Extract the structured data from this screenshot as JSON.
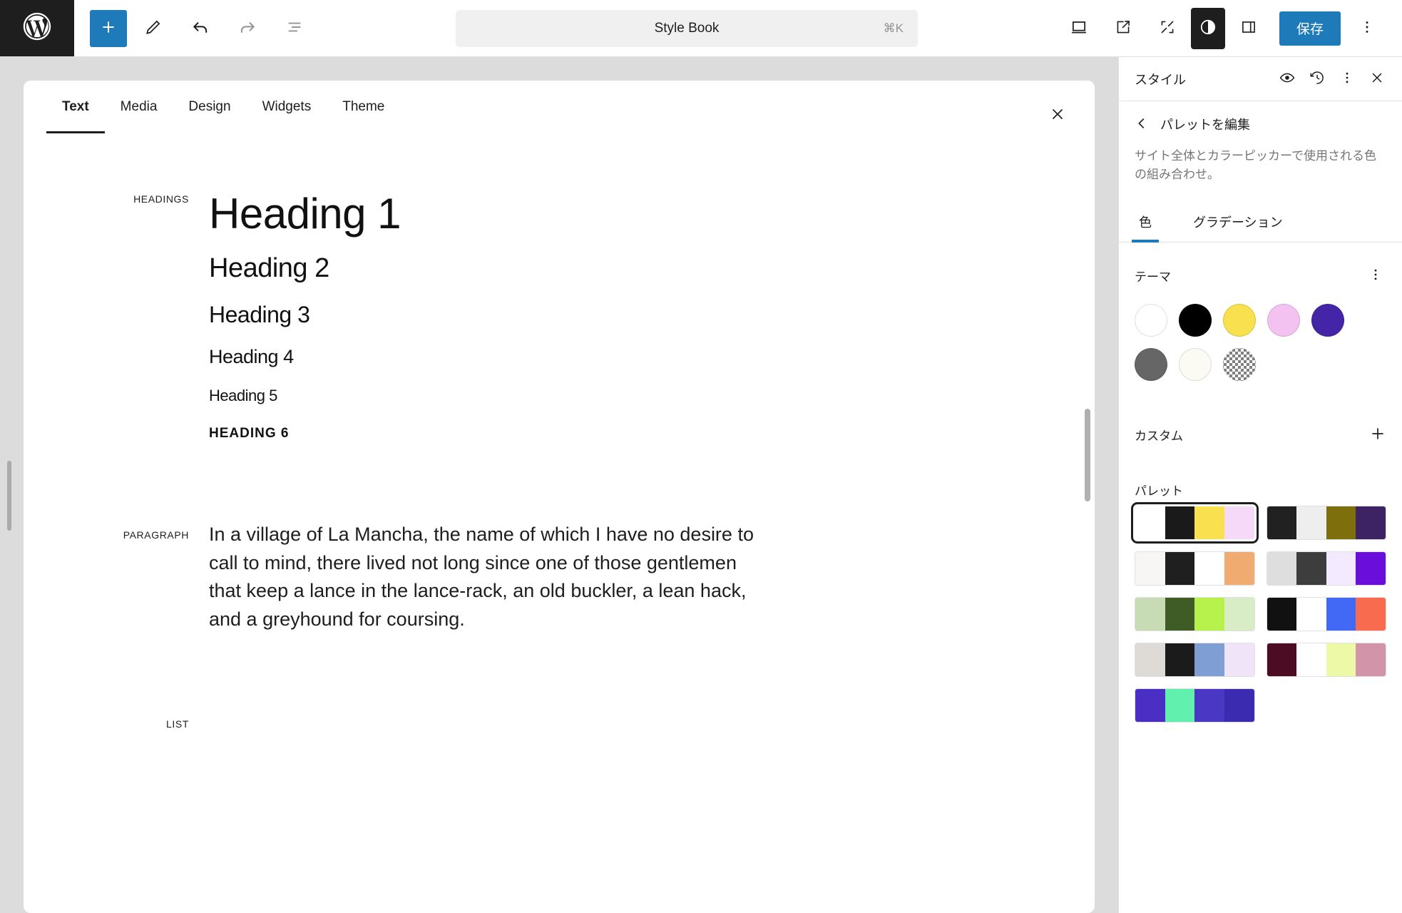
{
  "topbar": {
    "logo_icon": "wordpress-logo-icon",
    "tools": [
      {
        "name": "add-block-button",
        "icon": "plus-icon"
      },
      {
        "name": "edit-tool-button",
        "icon": "pencil-icon"
      },
      {
        "name": "undo-button",
        "icon": "undo-arrow-icon"
      },
      {
        "name": "redo-button",
        "icon": "redo-arrow-icon"
      },
      {
        "name": "document-overview-button",
        "icon": "list-view-icon"
      }
    ],
    "command_bar": {
      "title": "Style Book",
      "shortcut": "⌘K"
    },
    "right_tools": [
      {
        "name": "device-preview-button",
        "icon": "desktop-icon"
      },
      {
        "name": "view-site-button",
        "icon": "external-link-icon"
      },
      {
        "name": "zoom-out-button",
        "icon": "expand-icon"
      },
      {
        "name": "style-book-toggle-button",
        "icon": "contrast-circle-icon"
      },
      {
        "name": "settings-sidebar-button",
        "icon": "sidebar-panel-icon"
      }
    ],
    "save_label": "保存",
    "more_menu_icon": "three-dots-vertical-icon"
  },
  "stylebook": {
    "tabs": [
      {
        "label": "Text",
        "active": true
      },
      {
        "label": "Media",
        "active": false
      },
      {
        "label": "Design",
        "active": false
      },
      {
        "label": "Widgets",
        "active": false
      },
      {
        "label": "Theme",
        "active": false
      }
    ],
    "close_icon": "close-x-icon",
    "sections": [
      {
        "label": "HEADINGS",
        "headings": [
          {
            "text": "Heading 1",
            "level": "h1"
          },
          {
            "text": "Heading 2",
            "level": "h2"
          },
          {
            "text": "Heading 3",
            "level": "h3"
          },
          {
            "text": "Heading 4",
            "level": "h4"
          },
          {
            "text": "Heading 5",
            "level": "h5"
          },
          {
            "text": "HEADING 6",
            "level": "h6"
          }
        ]
      },
      {
        "label": "PARAGRAPH",
        "paragraph": "In a village of La Mancha, the name of which I have no desire to call to mind, there lived not long since one of those gentlemen that keep a lance in the lance-rack, an old buckler, a lean hack, and a greyhound for coursing."
      },
      {
        "label": "LIST"
      }
    ]
  },
  "sidebar": {
    "title": "スタイル",
    "header_icons": [
      {
        "name": "style-preview-eye-icon"
      },
      {
        "name": "revisions-history-icon"
      },
      {
        "name": "more-options-icon"
      },
      {
        "name": "close-sidebar-icon"
      }
    ],
    "nav": {
      "back_icon": "chevron-left-icon",
      "title": "パレットを編集"
    },
    "description": "サイト全体とカラーピッカーで使用される色の組み合わせ。",
    "tabs": [
      {
        "label": "色",
        "active": true
      },
      {
        "label": "グラデーション",
        "active": false
      }
    ],
    "theme_section": {
      "title": "テーマ",
      "menu_icon": "three-dots-vertical-icon",
      "swatches": [
        {
          "name": "swatch-white",
          "color": "#ffffff"
        },
        {
          "name": "swatch-black",
          "color": "#000000"
        },
        {
          "name": "swatch-yellow",
          "color": "#f8e04f"
        },
        {
          "name": "swatch-pink",
          "color": "#f3c2f0"
        },
        {
          "name": "swatch-purple",
          "color": "#4425a8"
        },
        {
          "name": "swatch-gray",
          "color": "#666666"
        },
        {
          "name": "swatch-cream",
          "color": "#fbfaf3"
        },
        {
          "name": "swatch-transparent",
          "color": "checker"
        }
      ]
    },
    "custom_section": {
      "title": "カスタム",
      "add_icon": "plus-icon"
    },
    "palette_section": {
      "title": "パレット",
      "palettes": [
        {
          "name": "palette-default",
          "selected": true,
          "colors": [
            "#ffffff",
            "#1a1a1a",
            "#f8e04f",
            "#f6d9f8"
          ]
        },
        {
          "name": "palette-2",
          "selected": false,
          "colors": [
            "#212121",
            "#eeeeee",
            "#7c6f0c",
            "#3d2264"
          ]
        },
        {
          "name": "palette-3",
          "selected": false,
          "colors": [
            "#f7f6f4",
            "#1f1f1f",
            "#ffffff",
            "#f0ab71"
          ]
        },
        {
          "name": "palette-4",
          "selected": false,
          "colors": [
            "#dedede",
            "#3d3d3d",
            "#f3eaff",
            "#6a0fdb"
          ]
        },
        {
          "name": "palette-5",
          "selected": false,
          "colors": [
            "#c7dcb5",
            "#3f5c26",
            "#b6f24b",
            "#d8edc5"
          ]
        },
        {
          "name": "palette-6",
          "selected": false,
          "colors": [
            "#111111",
            "#ffffff",
            "#4169f5",
            "#f86b4e"
          ]
        },
        {
          "name": "palette-7",
          "selected": false,
          "colors": [
            "#dedad5",
            "#1b1b1b",
            "#7f9fd4",
            "#efe4f8"
          ]
        },
        {
          "name": "palette-8",
          "selected": false,
          "colors": [
            "#4b0c24",
            "#ffffff",
            "#eef9a8",
            "#d194a8"
          ]
        },
        {
          "name": "palette-9",
          "selected": false,
          "colors": [
            "#4b2fc4",
            "#62f0ae",
            "#4a38c4",
            "#3b2bb0"
          ]
        }
      ]
    }
  }
}
